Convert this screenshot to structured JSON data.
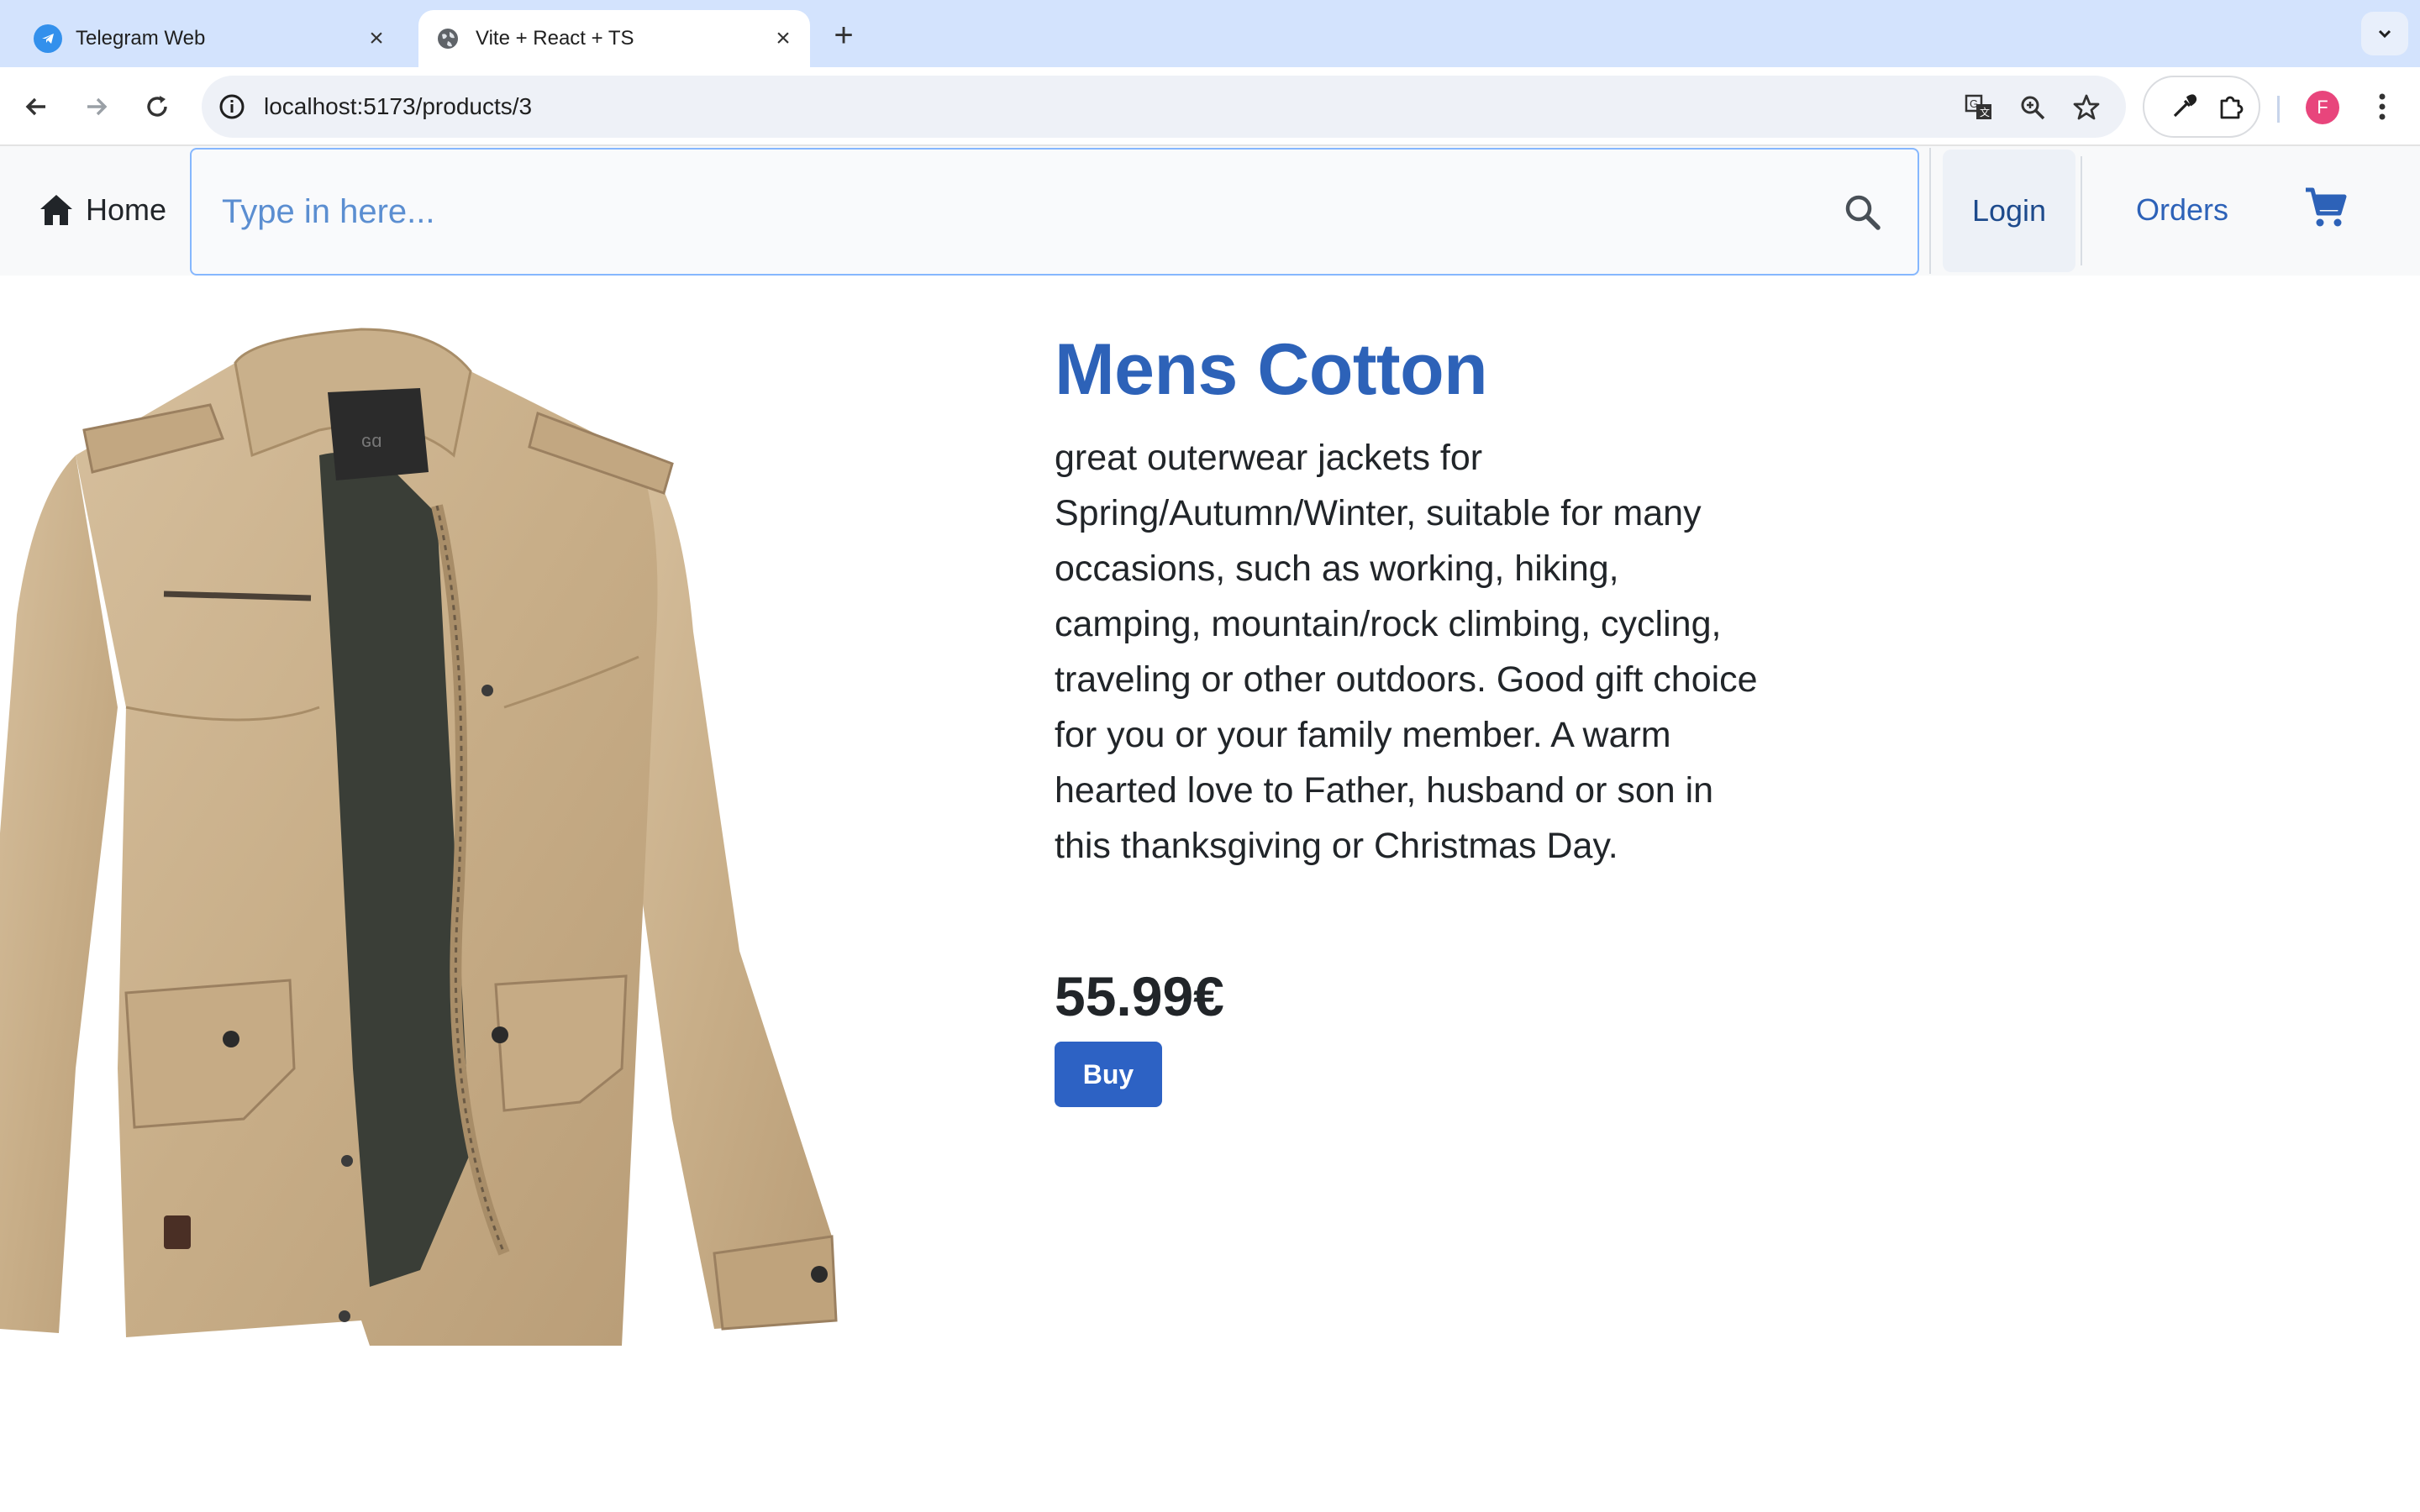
{
  "browser": {
    "tabs": [
      {
        "title": "Telegram Web",
        "active": false,
        "favicon": "telegram-icon"
      },
      {
        "title": "Vite + React + TS",
        "active": true,
        "favicon": "globe-icon"
      }
    ],
    "new_tab": "+",
    "address": "localhost:5173/products/3",
    "profile_initial": "F",
    "accent": "#d3e3fd"
  },
  "navbar": {
    "home_label": "Home",
    "search_placeholder": "Type in here...",
    "login_label": "Login",
    "orders_label": "Orders",
    "link_color": "#2d62b8"
  },
  "product": {
    "title": "Mens Cotton",
    "description": "great outerwear jackets for Spring/Autumn/Winter, suitable for many occasions, such as working, hiking, camping, mountain/rock climbing, cycling, traveling or other outdoors. Good gift choice for you or your family member. A warm hearted love to Father, husband or son in this thanksgiving or Christmas Day.",
    "price": "55.99€",
    "buy_label": "Buy",
    "image": "khaki-jacket-photo"
  }
}
